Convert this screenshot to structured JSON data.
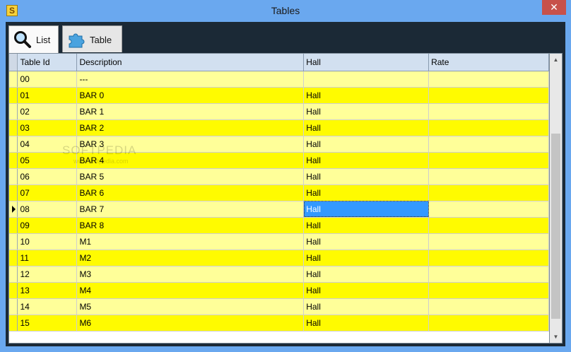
{
  "window": {
    "title": "Tables",
    "close_glyph": "✕",
    "app_icon_letter": "S"
  },
  "tabs": [
    {
      "label": "List",
      "icon": "magnifier-icon",
      "active": true
    },
    {
      "label": "Table",
      "icon": "puzzle-icon",
      "active": false
    }
  ],
  "grid": {
    "columns": [
      "Table Id",
      "Description",
      "Hall",
      "Rate"
    ],
    "current_row": 8,
    "selected_cell": {
      "row": 8,
      "column": 2
    },
    "rows": [
      [
        "00",
        "---",
        "",
        ""
      ],
      [
        "01",
        "BAR 0",
        "Hall",
        ""
      ],
      [
        "02",
        "BAR 1",
        "Hall",
        ""
      ],
      [
        "03",
        "BAR 2",
        "Hall",
        ""
      ],
      [
        "04",
        "BAR 3",
        "Hall",
        ""
      ],
      [
        "05",
        "BAR 4",
        "Hall",
        ""
      ],
      [
        "06",
        "BAR 5",
        "Hall",
        ""
      ],
      [
        "07",
        "BAR 6",
        "Hall",
        ""
      ],
      [
        "08",
        "BAR 7",
        "Hall",
        ""
      ],
      [
        "09",
        "BAR 8",
        "Hall",
        ""
      ],
      [
        "10",
        "M1",
        "Hall",
        ""
      ],
      [
        "11",
        "M2",
        "Hall",
        ""
      ],
      [
        "12",
        "M3",
        "Hall",
        ""
      ],
      [
        "13",
        "M4",
        "Hall",
        ""
      ],
      [
        "14",
        "M5",
        "Hall",
        ""
      ],
      [
        "15",
        "M6",
        "Hall",
        ""
      ]
    ]
  },
  "colors": {
    "row_a": "#fffb00",
    "row_b": "#ffff99",
    "selection": "#3399ff",
    "title_bar": "#6aa8ef",
    "close": "#c7514a"
  },
  "watermark": {
    "main": "SOFTPEDIA",
    "sub": "www.softpedia.com"
  }
}
